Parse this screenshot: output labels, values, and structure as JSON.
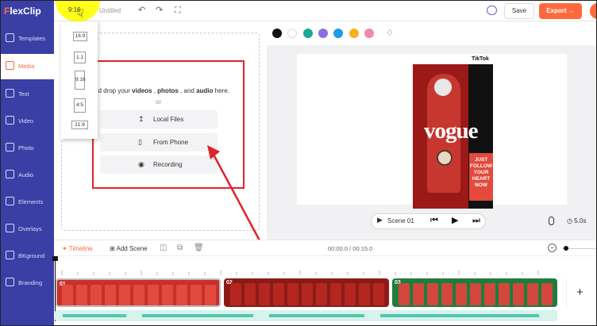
{
  "app": {
    "logo": "FlexClip",
    "doc_title": "Untitled"
  },
  "topbar": {
    "ratio": "9:16",
    "save": "Save",
    "export": "Export →"
  },
  "sidebar": {
    "items": [
      {
        "label": "Templates",
        "icon": "templates-icon"
      },
      {
        "label": "Media",
        "icon": "media-icon",
        "active": true
      },
      {
        "label": "Text",
        "icon": "text-icon"
      },
      {
        "label": "Video",
        "icon": "video-icon"
      },
      {
        "label": "Photo",
        "icon": "photo-icon"
      },
      {
        "label": "Audio",
        "icon": "audio-icon"
      },
      {
        "label": "Elements",
        "icon": "elements-icon"
      },
      {
        "label": "Overlays",
        "icon": "overlays-icon"
      },
      {
        "label": "BKground",
        "icon": "background-icon"
      },
      {
        "label": "Branding",
        "icon": "branding-icon"
      }
    ]
  },
  "ratio_menu": {
    "options": [
      "16:9",
      "1:1",
      "9:16",
      "4:5",
      "21:9"
    ],
    "selected": "9:16"
  },
  "media": {
    "drop_prefix": "nd drop your ",
    "drop_videos": "videos",
    "drop_sep1": " , ",
    "drop_photos": "photos",
    "drop_sep2": " , and ",
    "drop_audio": "audio",
    "drop_suffix": " here.",
    "or": "or",
    "local_files": "Local Files",
    "from_phone": "From Phone",
    "recording": "Recording"
  },
  "colors": {
    "swatches": [
      "#111111",
      "#ffffff",
      "#1aa79a",
      "#8c6ee0",
      "#1f9be8",
      "#f5b21c",
      "#f08aa9"
    ],
    "accent": "#ff6a3d",
    "sidebar": "#3a3fa6",
    "annotation": "#e2222a"
  },
  "preview": {
    "platform": "TikTok",
    "headline": "vogue",
    "slogan_lines": [
      "JUST",
      "FOLLOW",
      "YOUR",
      "HEART",
      "NOW"
    ],
    "scene": "Scene 01",
    "duration": "5.0s"
  },
  "timeline": {
    "tab": "Timeline",
    "add_scene": "Add Scene",
    "time": "00:00.0 / 00:15.0",
    "clips": [
      {
        "label": "01",
        "color": "#c9302c"
      },
      {
        "label": "02",
        "color": "#b52621"
      },
      {
        "label": "03",
        "color": "#1e7d3d"
      }
    ],
    "add": "+"
  }
}
